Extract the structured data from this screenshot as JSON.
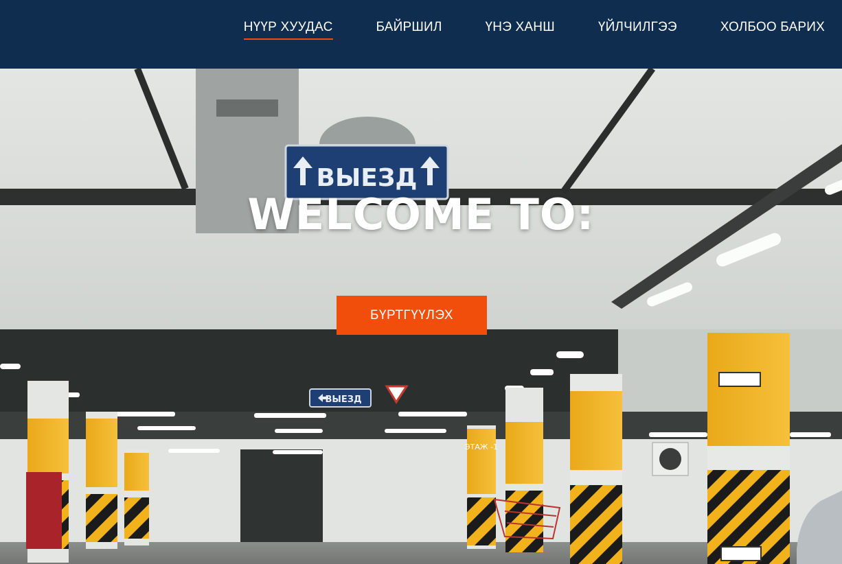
{
  "nav": {
    "items": [
      {
        "label": "НҮҮР ХУУДАС",
        "active": true
      },
      {
        "label": "БАЙРШИЛ",
        "active": false
      },
      {
        "label": "ҮНЭ ХАНШ",
        "active": false
      },
      {
        "label": "ҮЙЛЧИЛГЭЭ",
        "active": false
      },
      {
        "label": "ХОЛБОО БАРИХ",
        "active": false
      }
    ]
  },
  "hero": {
    "title": "WELCOME TO:",
    "button_label": "БҮРТГҮҮЛЭХ",
    "image_text": {
      "exit_sign_big": "ВЫЕЗД",
      "exit_sign_small": "ВЫЕЗД",
      "floor_marker": "ЭТАЖ -1"
    }
  },
  "colors": {
    "nav_background": "#0f2d4e",
    "accent": "#f04e0a",
    "text_light": "#ffffff"
  }
}
